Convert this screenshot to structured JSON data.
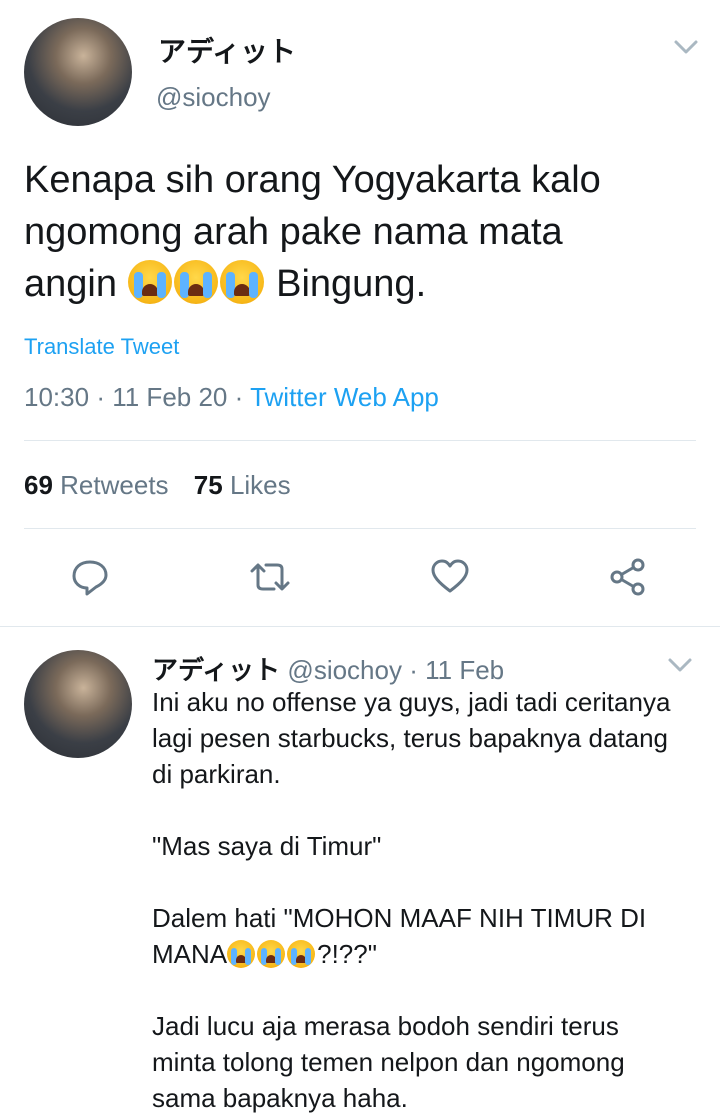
{
  "tweet": {
    "display_name": "アディット",
    "handle": "@siochoy",
    "text_line1": "Kenapa sih orang Yogyakarta kalo",
    "text_line2": "ngomong arah pake nama mata",
    "text_line3_prefix": "angin",
    "text_line3_suffix": "Bingung.",
    "translate_label": "Translate Tweet",
    "time": "10:30",
    "date": "11 Feb 20",
    "separator": "·",
    "source": "Twitter Web App",
    "retweets_count": "69",
    "retweets_label": "Retweets",
    "likes_count": "75",
    "likes_label": "Likes"
  },
  "icons": {
    "reply": "speech-bubble",
    "retweet": "retweet-arrows",
    "like": "heart",
    "share": "share-nodes",
    "more": "chevron-down",
    "emoji": "loudly-crying-face"
  },
  "reply": {
    "display_name": "アディット",
    "handle": "@siochoy",
    "separator": "·",
    "date": "11 Feb",
    "line1": "Ini aku no offense ya guys, jadi tadi ceritanya",
    "line2": "lagi pesen starbucks, terus bapaknya datang",
    "line3": "di parkiran.",
    "line4": "\"Mas saya di Timur\"",
    "line5": "Dalem hati \"MOHON MAAF NIH TIMUR DI",
    "line6_prefix": "MANA",
    "line6_suffix": "?!??\"",
    "line7": "Jadi lucu aja merasa bodoh sendiri terus",
    "line8": "minta tolong temen nelpon dan ngomong",
    "line9": "sama bapaknya haha."
  },
  "colors": {
    "link": "#1da1f2",
    "muted": "#657786",
    "divider": "#e1e8ed",
    "text": "#14171a"
  }
}
